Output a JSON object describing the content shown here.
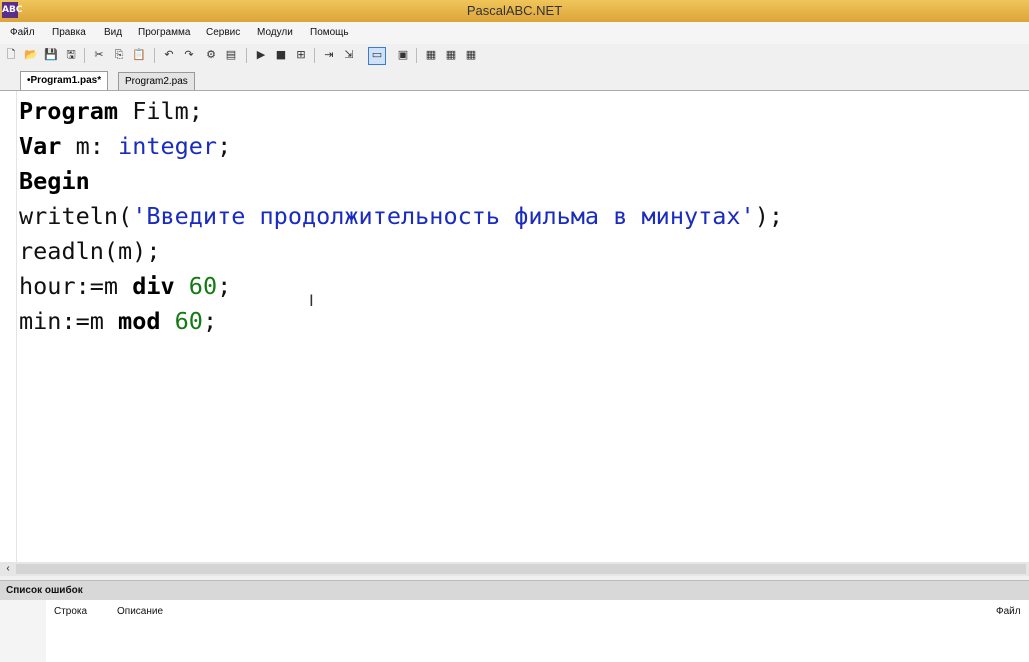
{
  "window": {
    "title": "PascalABC.NET",
    "icon": "ABC"
  },
  "menu": [
    {
      "label": "Файл"
    },
    {
      "label": "Правка"
    },
    {
      "label": "Вид"
    },
    {
      "label": "Программа"
    },
    {
      "label": "Сервис"
    },
    {
      "label": "Модули"
    },
    {
      "label": "Помощь"
    }
  ],
  "toolbar": [
    {
      "name": "new-file-icon",
      "glyph": "🗋"
    },
    {
      "name": "open-icon",
      "glyph": "📂"
    },
    {
      "name": "save-icon",
      "glyph": "💾"
    },
    {
      "name": "save-all-icon",
      "glyph": "🖫"
    },
    {
      "name": "cut-icon",
      "glyph": "✂"
    },
    {
      "name": "copy-icon",
      "glyph": "⎘"
    },
    {
      "name": "paste-icon",
      "glyph": "📋"
    },
    {
      "name": "undo-icon",
      "glyph": "↶"
    },
    {
      "name": "redo-icon",
      "glyph": "↷"
    },
    {
      "name": "compile-icon",
      "glyph": "⚙"
    },
    {
      "name": "build-icon",
      "glyph": "▤"
    },
    {
      "name": "run-icon",
      "glyph": "▶"
    },
    {
      "name": "stop-icon",
      "glyph": "■"
    },
    {
      "name": "debug-icon",
      "glyph": "⊞"
    },
    {
      "name": "step-over-icon",
      "glyph": "⇥"
    },
    {
      "name": "step-into-icon",
      "glyph": "⇲"
    },
    {
      "name": "console-icon",
      "glyph": "▭"
    },
    {
      "name": "format-icon",
      "glyph": "▣"
    },
    {
      "name": "window1-icon",
      "glyph": "▦"
    },
    {
      "name": "window2-icon",
      "glyph": "▦"
    },
    {
      "name": "window3-icon",
      "glyph": "▦"
    }
  ],
  "tabs": [
    {
      "label": "•Program1.pas*",
      "active": true
    },
    {
      "label": "Program2.pas",
      "active": false
    }
  ],
  "code": [
    [
      {
        "t": "kw",
        "v": "Program"
      },
      {
        "t": "id",
        "v": " Film;"
      }
    ],
    [
      {
        "t": "kw",
        "v": "Var"
      },
      {
        "t": "id",
        "v": " m: "
      },
      {
        "t": "typ",
        "v": "integer"
      },
      {
        "t": "id",
        "v": ";"
      }
    ],
    [
      {
        "t": "kw",
        "v": "Begin"
      }
    ],
    [
      {
        "t": "id",
        "v": "writeln("
      },
      {
        "t": "str",
        "v": "'Введите продолжительность фильма в минутах'"
      },
      {
        "t": "id",
        "v": ");"
      }
    ],
    [
      {
        "t": "id",
        "v": "readln(m);"
      }
    ],
    [
      {
        "t": "id",
        "v": "hour:=m "
      },
      {
        "t": "kw",
        "v": "div"
      },
      {
        "t": "id",
        "v": " "
      },
      {
        "t": "num",
        "v": "60"
      },
      {
        "t": "id",
        "v": ";"
      }
    ],
    [
      {
        "t": "id",
        "v": "min:=m "
      },
      {
        "t": "kw",
        "v": "mod"
      },
      {
        "t": "id",
        "v": " "
      },
      {
        "t": "num",
        "v": "60"
      },
      {
        "t": "id",
        "v": ";"
      }
    ]
  ],
  "errors": {
    "title": "Список ошибок",
    "col_line": "Строка",
    "col_desc": "Описание",
    "col_file": "Файл"
  },
  "colors": {
    "titlebar": "#e8b84a",
    "keyword": "#000000",
    "type": "#1a2bbf",
    "string": "#1a2bbf",
    "number": "#147a14"
  }
}
